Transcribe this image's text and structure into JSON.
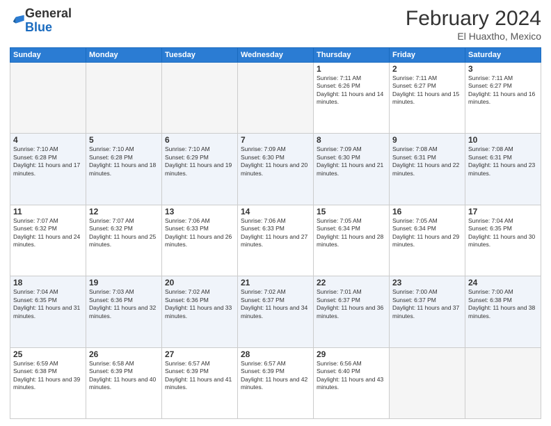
{
  "header": {
    "logo_general": "General",
    "logo_blue": "Blue",
    "month_title": "February 2024",
    "location": "El Huaxtho, Mexico"
  },
  "weekdays": [
    "Sunday",
    "Monday",
    "Tuesday",
    "Wednesday",
    "Thursday",
    "Friday",
    "Saturday"
  ],
  "weeks": [
    [
      {
        "day": "",
        "info": ""
      },
      {
        "day": "",
        "info": ""
      },
      {
        "day": "",
        "info": ""
      },
      {
        "day": "",
        "info": ""
      },
      {
        "day": "1",
        "info": "Sunrise: 7:11 AM\nSunset: 6:26 PM\nDaylight: 11 hours and 14 minutes."
      },
      {
        "day": "2",
        "info": "Sunrise: 7:11 AM\nSunset: 6:27 PM\nDaylight: 11 hours and 15 minutes."
      },
      {
        "day": "3",
        "info": "Sunrise: 7:11 AM\nSunset: 6:27 PM\nDaylight: 11 hours and 16 minutes."
      }
    ],
    [
      {
        "day": "4",
        "info": "Sunrise: 7:10 AM\nSunset: 6:28 PM\nDaylight: 11 hours and 17 minutes."
      },
      {
        "day": "5",
        "info": "Sunrise: 7:10 AM\nSunset: 6:28 PM\nDaylight: 11 hours and 18 minutes."
      },
      {
        "day": "6",
        "info": "Sunrise: 7:10 AM\nSunset: 6:29 PM\nDaylight: 11 hours and 19 minutes."
      },
      {
        "day": "7",
        "info": "Sunrise: 7:09 AM\nSunset: 6:30 PM\nDaylight: 11 hours and 20 minutes."
      },
      {
        "day": "8",
        "info": "Sunrise: 7:09 AM\nSunset: 6:30 PM\nDaylight: 11 hours and 21 minutes."
      },
      {
        "day": "9",
        "info": "Sunrise: 7:08 AM\nSunset: 6:31 PM\nDaylight: 11 hours and 22 minutes."
      },
      {
        "day": "10",
        "info": "Sunrise: 7:08 AM\nSunset: 6:31 PM\nDaylight: 11 hours and 23 minutes."
      }
    ],
    [
      {
        "day": "11",
        "info": "Sunrise: 7:07 AM\nSunset: 6:32 PM\nDaylight: 11 hours and 24 minutes."
      },
      {
        "day": "12",
        "info": "Sunrise: 7:07 AM\nSunset: 6:32 PM\nDaylight: 11 hours and 25 minutes."
      },
      {
        "day": "13",
        "info": "Sunrise: 7:06 AM\nSunset: 6:33 PM\nDaylight: 11 hours and 26 minutes."
      },
      {
        "day": "14",
        "info": "Sunrise: 7:06 AM\nSunset: 6:33 PM\nDaylight: 11 hours and 27 minutes."
      },
      {
        "day": "15",
        "info": "Sunrise: 7:05 AM\nSunset: 6:34 PM\nDaylight: 11 hours and 28 minutes."
      },
      {
        "day": "16",
        "info": "Sunrise: 7:05 AM\nSunset: 6:34 PM\nDaylight: 11 hours and 29 minutes."
      },
      {
        "day": "17",
        "info": "Sunrise: 7:04 AM\nSunset: 6:35 PM\nDaylight: 11 hours and 30 minutes."
      }
    ],
    [
      {
        "day": "18",
        "info": "Sunrise: 7:04 AM\nSunset: 6:35 PM\nDaylight: 11 hours and 31 minutes."
      },
      {
        "day": "19",
        "info": "Sunrise: 7:03 AM\nSunset: 6:36 PM\nDaylight: 11 hours and 32 minutes."
      },
      {
        "day": "20",
        "info": "Sunrise: 7:02 AM\nSunset: 6:36 PM\nDaylight: 11 hours and 33 minutes."
      },
      {
        "day": "21",
        "info": "Sunrise: 7:02 AM\nSunset: 6:37 PM\nDaylight: 11 hours and 34 minutes."
      },
      {
        "day": "22",
        "info": "Sunrise: 7:01 AM\nSunset: 6:37 PM\nDaylight: 11 hours and 36 minutes."
      },
      {
        "day": "23",
        "info": "Sunrise: 7:00 AM\nSunset: 6:37 PM\nDaylight: 11 hours and 37 minutes."
      },
      {
        "day": "24",
        "info": "Sunrise: 7:00 AM\nSunset: 6:38 PM\nDaylight: 11 hours and 38 minutes."
      }
    ],
    [
      {
        "day": "25",
        "info": "Sunrise: 6:59 AM\nSunset: 6:38 PM\nDaylight: 11 hours and 39 minutes."
      },
      {
        "day": "26",
        "info": "Sunrise: 6:58 AM\nSunset: 6:39 PM\nDaylight: 11 hours and 40 minutes."
      },
      {
        "day": "27",
        "info": "Sunrise: 6:57 AM\nSunset: 6:39 PM\nDaylight: 11 hours and 41 minutes."
      },
      {
        "day": "28",
        "info": "Sunrise: 6:57 AM\nSunset: 6:39 PM\nDaylight: 11 hours and 42 minutes."
      },
      {
        "day": "29",
        "info": "Sunrise: 6:56 AM\nSunset: 6:40 PM\nDaylight: 11 hours and 43 minutes."
      },
      {
        "day": "",
        "info": ""
      },
      {
        "day": "",
        "info": ""
      }
    ]
  ]
}
